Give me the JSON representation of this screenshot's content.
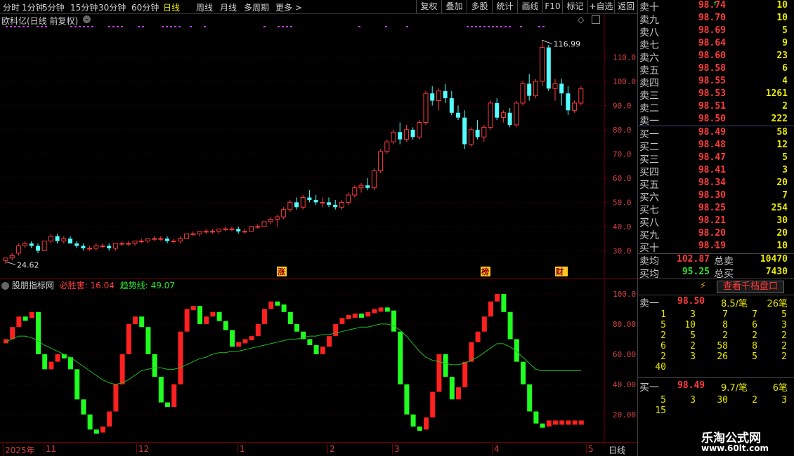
{
  "toolbar": {
    "periods": [
      "分时",
      "1分钟",
      "5分钟",
      "15分钟",
      "30分钟",
      "60分钟",
      "日线",
      "周线",
      "月线",
      "多周期",
      "更多 >"
    ],
    "active": "日线",
    "buttons": [
      "复权",
      "叠加",
      "多股",
      "统计",
      "画线",
      "F10",
      "标记",
      "+自选",
      "返回"
    ]
  },
  "chart": {
    "title": "欧科亿(日线 前复权)",
    "y_ticks": [
      "110.0",
      "100.0",
      "90.0",
      "80.0",
      "70.0",
      "60.0",
      "50.0",
      "40.0",
      "30.0"
    ],
    "high_label": "116.99",
    "low_label": "24.62",
    "markers": [
      "涨",
      "榜",
      "财"
    ]
  },
  "indicator": {
    "name": "股朋指标网",
    "line1_label": "必胜害: 16.04",
    "line2_label": "趋势线: 49.07",
    "y_ticks": [
      "100.0",
      "80.00",
      "60.00",
      "40.00",
      "20.00"
    ]
  },
  "x_axis": {
    "labels": [
      "2025年",
      "11",
      "12",
      "1",
      "2",
      "3",
      "4",
      "5"
    ],
    "period_label": "日线"
  },
  "orderbook": {
    "asks": [
      {
        "label": "卖十",
        "price": "98.74",
        "vol": "10"
      },
      {
        "label": "卖九",
        "price": "98.70",
        "vol": "10"
      },
      {
        "label": "卖八",
        "price": "98.69",
        "vol": "5"
      },
      {
        "label": "卖七",
        "price": "98.64",
        "vol": "9"
      },
      {
        "label": "卖六",
        "price": "98.60",
        "vol": "23"
      },
      {
        "label": "卖五",
        "price": "98.58",
        "vol": "6"
      },
      {
        "label": "卖四",
        "price": "98.55",
        "vol": "4"
      },
      {
        "label": "卖三",
        "price": "98.53",
        "vol": "1261"
      },
      {
        "label": "卖二",
        "price": "98.51",
        "vol": "2"
      },
      {
        "label": "卖一",
        "price": "98.50",
        "vol": "222"
      }
    ],
    "bids": [
      {
        "label": "买一",
        "price": "98.49",
        "vol": "58"
      },
      {
        "label": "买二",
        "price": "98.48",
        "vol": "12"
      },
      {
        "label": "买三",
        "price": "98.47",
        "vol": "5"
      },
      {
        "label": "买四",
        "price": "98.41",
        "vol": "3"
      },
      {
        "label": "买五",
        "price": "98.34",
        "vol": "20"
      },
      {
        "label": "买六",
        "price": "98.30",
        "vol": "7"
      },
      {
        "label": "买七",
        "price": "98.25",
        "vol": "254"
      },
      {
        "label": "买八",
        "price": "98.21",
        "vol": "30"
      },
      {
        "label": "买九",
        "price": "98.20",
        "vol": "20"
      },
      {
        "label": "买十",
        "price": "98.19",
        "vol": "10"
      }
    ],
    "sell_avg": {
      "label": "卖均",
      "price": "102.87",
      "total_label": "总卖",
      "total": "10470"
    },
    "buy_avg": {
      "label": "买均",
      "price": "95.25",
      "total_label": "总买",
      "total": "7430"
    },
    "thousand_button": "查看千档盘口",
    "ask1_detail": {
      "label": "卖一",
      "price": "98.50",
      "avg": "8.5/笔",
      "count": "26笔"
    },
    "ask1_table": [
      [
        "1",
        "3",
        "7",
        "7",
        "5"
      ],
      [
        "5",
        "10",
        "8",
        "6",
        "3"
      ],
      [
        "2",
        "5",
        "2",
        "2",
        "2"
      ],
      [
        "6",
        "2",
        "58",
        "8",
        "2"
      ],
      [
        "2",
        "3",
        "26",
        "5",
        "2"
      ],
      [
        "40",
        "",
        "",
        "",
        ""
      ]
    ],
    "bid1_detail": {
      "label": "买一",
      "price": "98.49",
      "avg": "9.7/笔",
      "count": "6笔"
    },
    "bid1_table": [
      [
        "5",
        "3",
        "30",
        "2",
        "3"
      ],
      [
        "15",
        "",
        "",
        "",
        ""
      ]
    ]
  },
  "watermark": {
    "line1": "乐淘公式网",
    "line2": "www.60lt.com"
  },
  "chart_data": {
    "type": "candlestick",
    "ylim": [
      22,
      122
    ],
    "candles": [
      [
        26,
        27,
        24.6,
        27
      ],
      [
        27,
        29,
        26,
        28
      ],
      [
        29,
        33,
        28,
        32
      ],
      [
        32,
        34,
        31,
        33
      ],
      [
        33,
        34,
        31,
        32
      ],
      [
        32,
        33,
        29,
        30
      ],
      [
        30,
        34,
        30,
        34
      ],
      [
        34,
        37,
        33,
        36
      ],
      [
        36,
        37,
        33,
        34
      ],
      [
        34,
        36,
        33,
        35
      ],
      [
        35,
        36,
        33,
        33
      ],
      [
        33,
        34,
        31,
        32
      ],
      [
        32,
        33,
        30,
        31
      ],
      [
        31,
        32,
        30,
        31
      ],
      [
        31,
        33,
        30,
        32
      ],
      [
        32,
        33,
        31,
        32
      ],
      [
        32,
        33,
        30,
        31
      ],
      [
        31,
        33,
        30,
        33
      ],
      [
        33,
        34,
        32,
        33
      ],
      [
        33,
        34,
        32,
        33
      ],
      [
        33,
        34,
        32,
        34
      ],
      [
        34,
        35,
        33,
        34
      ],
      [
        34,
        35,
        33,
        35
      ],
      [
        35,
        36,
        34,
        35
      ],
      [
        35,
        36,
        34,
        35
      ],
      [
        35,
        36,
        33,
        34
      ],
      [
        34,
        35,
        33,
        34
      ],
      [
        34,
        36,
        33,
        35
      ],
      [
        35,
        37,
        35,
        37
      ],
      [
        37,
        38,
        36,
        37
      ],
      [
        37,
        38,
        36,
        38
      ],
      [
        38,
        39,
        37,
        38
      ],
      [
        38,
        39,
        37,
        38
      ],
      [
        38,
        39,
        37,
        39
      ],
      [
        39,
        40,
        38,
        39
      ],
      [
        39,
        40,
        38,
        39
      ],
      [
        39,
        40,
        37,
        38
      ],
      [
        38,
        39,
        37,
        38
      ],
      [
        38,
        40,
        38,
        40
      ],
      [
        40,
        41,
        39,
        40
      ],
      [
        40,
        42,
        40,
        42
      ],
      [
        42,
        44,
        41,
        43
      ],
      [
        43,
        45,
        40,
        44
      ],
      [
        44,
        48,
        43,
        47
      ],
      [
        47,
        51,
        46,
        50
      ],
      [
        50,
        52,
        47,
        48
      ],
      [
        48,
        53,
        47,
        52
      ],
      [
        52,
        55,
        50,
        51
      ],
      [
        51,
        53,
        49,
        50
      ],
      [
        50,
        52,
        48,
        50
      ],
      [
        50,
        52,
        48,
        49
      ],
      [
        49,
        51,
        47,
        48
      ],
      [
        48,
        51,
        47,
        50
      ],
      [
        50,
        54,
        49,
        53
      ],
      [
        53,
        57,
        52,
        56
      ],
      [
        56,
        58,
        54,
        57
      ],
      [
        57,
        60,
        55,
        56
      ],
      [
        56,
        64,
        55,
        63
      ],
      [
        63,
        72,
        62,
        71
      ],
      [
        71,
        76,
        70,
        75
      ],
      [
        75,
        80,
        74,
        79
      ],
      [
        79,
        83,
        74,
        76
      ],
      [
        76,
        82,
        75,
        80
      ],
      [
        80,
        81,
        76,
        77
      ],
      [
        77,
        84,
        76,
        83
      ],
      [
        83,
        96,
        82,
        95
      ],
      [
        95,
        98,
        90,
        92
      ],
      [
        92,
        97,
        88,
        96
      ],
      [
        96,
        99,
        91,
        93
      ],
      [
        93,
        96,
        86,
        87
      ],
      [
        87,
        90,
        84,
        85
      ],
      [
        85,
        88,
        72,
        74
      ],
      [
        74,
        81,
        73,
        80
      ],
      [
        80,
        84,
        76,
        77
      ],
      [
        77,
        82,
        75,
        81
      ],
      [
        81,
        92,
        80,
        91
      ],
      [
        91,
        93,
        84,
        85
      ],
      [
        85,
        88,
        83,
        87
      ],
      [
        87,
        89,
        81,
        82
      ],
      [
        82,
        92,
        81,
        91
      ],
      [
        91,
        100,
        90,
        99
      ],
      [
        99,
        103,
        92,
        94
      ],
      [
        94,
        101,
        93,
        100
      ],
      [
        100,
        117,
        98,
        114
      ],
      [
        114,
        115,
        96,
        97
      ],
      [
        97,
        101,
        92,
        99
      ],
      [
        99,
        101,
        90,
        95
      ],
      [
        95,
        98,
        86,
        88
      ],
      [
        88,
        92,
        87,
        91
      ],
      [
        91,
        98,
        90,
        97
      ]
    ],
    "indicator_series": [
      {
        "name": "必胜害",
        "values": [
          70,
          78,
          85,
          84,
          88,
          60,
          50,
          55,
          60,
          58,
          50,
          30,
          20,
          10,
          8,
          12,
          22,
          40,
          60,
          80,
          85,
          78,
          60,
          45,
          28,
          25,
          40,
          75,
          90,
          92,
          80,
          85,
          88,
          82,
          76,
          65,
          68,
          70,
          72,
          80,
          90,
          95,
          93,
          88,
          80,
          75,
          70,
          66,
          60,
          65,
          72,
          80,
          84,
          86,
          87,
          85,
          88,
          90,
          91,
          89,
          75,
          40,
          20,
          12,
          10,
          18,
          35,
          60,
          45,
          30,
          38,
          55,
          68,
          75,
          85,
          95,
          100,
          88,
          70,
          55,
          40,
          22,
          14,
          12,
          16,
          16,
          16,
          16,
          16,
          16
        ]
      },
      {
        "name": "趋势线",
        "values": [
          68,
          70,
          72,
          72,
          71,
          69,
          66,
          64,
          62,
          60,
          58,
          55,
          52,
          49,
          46,
          43,
          41,
          40,
          41,
          43,
          46,
          49,
          50,
          51,
          51,
          50,
          50,
          51,
          53,
          55,
          57,
          58,
          60,
          61,
          61,
          62,
          62,
          63,
          64,
          65,
          66,
          67,
          68,
          69,
          70,
          70,
          71,
          72,
          72,
          73,
          73,
          74,
          75,
          76,
          77,
          78,
          78,
          79,
          80,
          80,
          79,
          76,
          72,
          67,
          62,
          58,
          56,
          55,
          54,
          53,
          53,
          54,
          56,
          58,
          61,
          64,
          67,
          67,
          65,
          62,
          58,
          54,
          50,
          49,
          49,
          49,
          49,
          49,
          49,
          49
        ]
      }
    ]
  }
}
